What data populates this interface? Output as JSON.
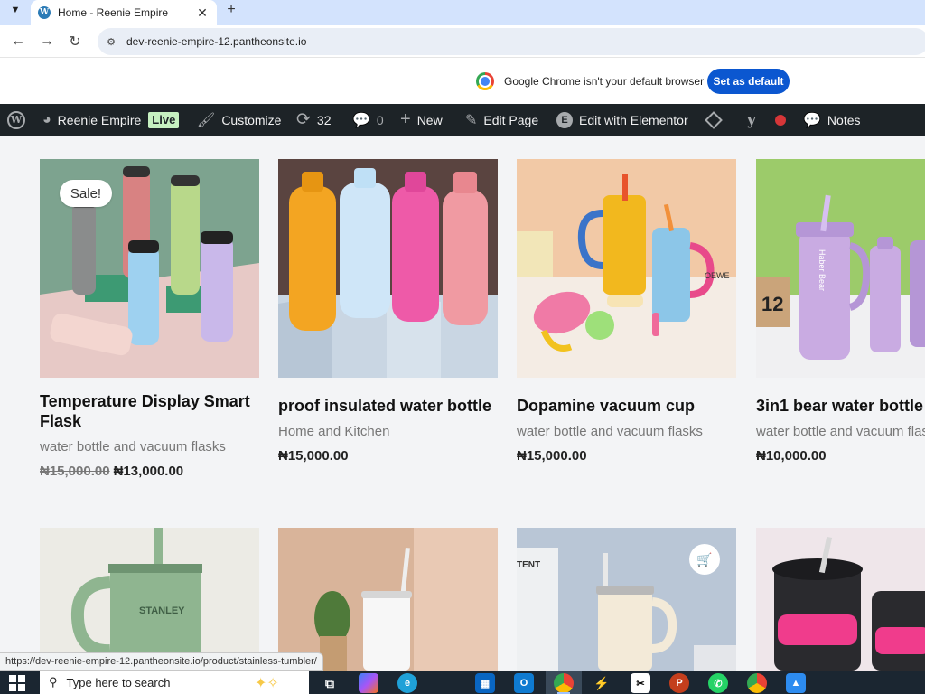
{
  "browser": {
    "tab_title": "Home - Reenie Empire",
    "tab_close": "✕",
    "new_tab": "+",
    "url": "dev-reenie-empire-12.pantheonsite.io",
    "infobar_text": "Google Chrome isn't your default browser",
    "set_default_label": "Set as default",
    "status_url": "https://dev-reenie-empire-12.pantheonsite.io/product/stainless-tumbler/"
  },
  "admin_bar": {
    "site_name": "Reenie Empire",
    "live_badge": "Live",
    "customize": "Customize",
    "updates_count": "32",
    "comments_count": "0",
    "new": "New",
    "edit_page": "Edit Page",
    "edit_elementor": "Edit with Elementor",
    "notes": "Notes"
  },
  "products": [
    {
      "title": "Temperature Display Smart Flask",
      "category": "water bottle and vacuum flasks",
      "old_price": "₦15,000.00",
      "price": "₦13,000.00",
      "sale_badge": "Sale!"
    },
    {
      "title": "proof insulated water bottle",
      "category": "Home and Kitchen",
      "price": "₦15,000.00"
    },
    {
      "title": "Dopamine vacuum cup",
      "category": "water bottle and vacuum flasks",
      "price": "₦15,000.00"
    },
    {
      "title": "3in1 bear water bottle",
      "category": "water bottle and vacuum flasks",
      "price": "₦10,000.00"
    }
  ],
  "image_labels": {
    "stanley": "STANLEY",
    "tent": "TENT",
    "haber_bear": "Haber Bear",
    "owe": "OEWE"
  },
  "taskbar": {
    "search_placeholder": "Type here to search"
  }
}
